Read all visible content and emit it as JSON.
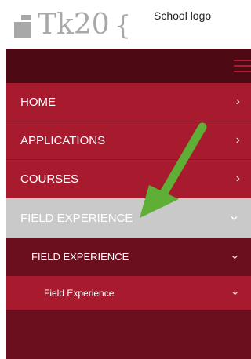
{
  "header": {
    "logo_text": "Tk20",
    "logo_brace": "{",
    "school_logo": "School logo"
  },
  "nav": {
    "items": [
      {
        "label": "HOME",
        "icon": "chevron-right-icon"
      },
      {
        "label": "APPLICATIONS",
        "icon": "chevron-right-icon"
      },
      {
        "label": "COURSES",
        "icon": "chevron-right-icon"
      },
      {
        "label": "FIELD EXPERIENCE",
        "icon": "chevron-down-icon"
      }
    ],
    "sub_item": {
      "label": "FIELD EXPERIENCE",
      "icon": "chevron-down-icon"
    },
    "sub_sub_item": {
      "label": "Field Experience",
      "icon": "chevron-down-icon"
    }
  },
  "glyphs": {
    "chevron_right": "›",
    "chevron_down": "⌄"
  },
  "colors": {
    "menu_red": "#a81b2f",
    "menu_dark": "#6b0f1e",
    "topbar": "#4e0a14",
    "active_gray": "#c9c9c9",
    "annotation_arrow": "#5fae35"
  }
}
